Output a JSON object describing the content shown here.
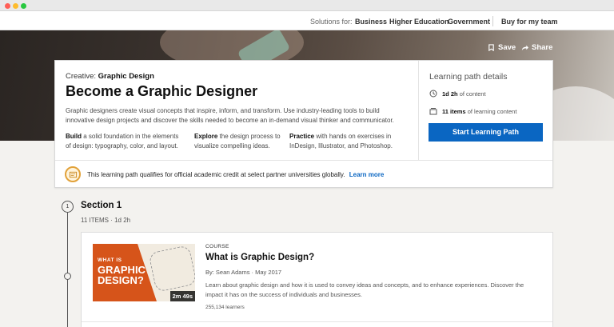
{
  "topnav": {
    "solutions_label": "Solutions for:",
    "links": [
      "Business",
      "Higher Education",
      "Government"
    ],
    "buy_label": "Buy for my team"
  },
  "hero": {
    "save_label": "Save",
    "share_label": "Share"
  },
  "path": {
    "category_prefix": "Creative:",
    "category": "Graphic Design",
    "title": "Become a Graphic Designer",
    "description": "Graphic designers create visual concepts that inspire, inform, and transform. Use industry-leading tools to build innovative design projects and discover the skills needed to become an in-demand visual thinker and communicator.",
    "features": [
      {
        "bold": "Build",
        "text": "a solid foundation in the elements of design: typography, color, and layout."
      },
      {
        "bold": "Explore",
        "text": "the design process to visualize compelling ideas."
      },
      {
        "bold": "Practice",
        "text": "with hands on exercises in InDesign, Illustrator, and Photoshop."
      }
    ]
  },
  "details": {
    "title": "Learning path details",
    "duration_value": "1d 2h",
    "duration_suffix": "of content",
    "items_value": "11 items",
    "items_suffix": "of learning content",
    "start_label": "Start Learning Path"
  },
  "credit": {
    "text": "This learning path qualifies for official academic credit at select partner universities globally.",
    "link": "Learn more"
  },
  "section": {
    "number": "1",
    "title": "Section 1",
    "items": "11 ITEMS",
    "duration": "1d 2h"
  },
  "course": {
    "kind": "COURSE",
    "title": "What is Graphic Design?",
    "author": "By: Sean Adams",
    "date": "May 2017",
    "description": "Learn about graphic design and how it is used to convey ideas and concepts, and to enhance experiences. Discover the impact it has on the success of individuals and businesses.",
    "learners": "255,134 learners",
    "thumb_line1": "WHAT IS",
    "thumb_line2": "GRAPHIC DESIGN?",
    "duration": "2m 49s"
  },
  "colors": {
    "accent": "#0a66c2",
    "thumb_orange": "#d6541a",
    "badge": "#e2a23a"
  }
}
